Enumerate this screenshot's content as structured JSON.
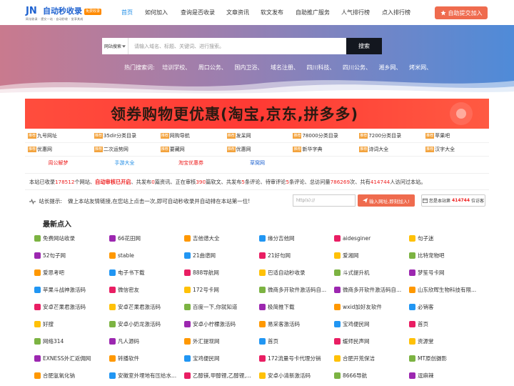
{
  "header": {
    "logo_mark": "JN",
    "logo_title": "自动秒收录",
    "logo_badge": "免费收录",
    "logo_sub": "网址收录 · 提交一站 · 自动秒收 · 坐享其成",
    "nav": [
      "首页",
      "如何加入",
      "查询是否收录",
      "文章资讯",
      "软文发布",
      "自助推广服务",
      "人气排行榜",
      "点入排行榜"
    ],
    "submit_label": "自助提交加入"
  },
  "search": {
    "select_label": "网站搜索",
    "placeholder": "请输入域名、标题、关键词、进行搜索。",
    "button": "搜索",
    "hot_label": "热门搜索词:",
    "hot_words": [
      "培训学校、",
      "周口公务、",
      "国内卫浴、",
      "域名注册、",
      "四川科技、",
      "四川公务、",
      "湘乡网、",
      "烤米网、"
    ]
  },
  "banner": {
    "text": "领券购物更优惠(淘宝,京东,拼多多)"
  },
  "link_rows": [
    [
      {
        "tag": "推荐",
        "label": "九号网址"
      },
      {
        "tag": "推荐",
        "label": "35dir分类目录"
      },
      {
        "tag": "推荐",
        "label": "网购导航"
      },
      {
        "tag": "推荐",
        "label": "发呆网"
      },
      {
        "tag": "推荐",
        "label": "78000分类目录"
      },
      {
        "tag": "推荐",
        "label": "7200分类目录"
      },
      {
        "tag": "推荐",
        "label": "苹果吧"
      }
    ],
    [
      {
        "tag": "推荐",
        "label": "优惠网"
      },
      {
        "tag": "推荐",
        "label": "二次运势网"
      },
      {
        "tag": "推荐",
        "label": "要藏网"
      },
      {
        "tag": "推荐",
        "label": "优惠网"
      },
      {
        "tag": "推荐",
        "label": "新华字典"
      },
      {
        "tag": "推荐",
        "label": "诗词大全"
      },
      {
        "tag": "推荐",
        "label": "汉字大全"
      }
    ]
  ],
  "special_links": [
    {
      "label": "周公解梦",
      "color": "#e22"
    },
    {
      "label": "手游大全",
      "color": "#1e8ce6"
    },
    {
      "label": "淘宝优惠券",
      "color": "#e22"
    },
    {
      "label": "草窝网",
      "color": "#1e62d0"
    }
  ],
  "stats": {
    "p1": "本站已收录",
    "n1": "178512",
    "p2": "个网站、",
    "audit": "自动审核已开启",
    "p3": "、共发布",
    "n2": "0",
    "p4": "篇资讯、正在审核",
    "n3": "390",
    "p5": "篇软文、共发布",
    "n4": "5",
    "p6": "条评论、待审评论",
    "n5": "5",
    "p7": "条评论、总访问量",
    "n6": "786269",
    "p8": "次、共有",
    "n7": "414744",
    "p9": "人访问过本站。"
  },
  "tip": {
    "label": "站长提示:",
    "text": "做上本站友情链接,在您站上点击一次,即可自动秒收录并自动排在本站第一位!",
    "input_placeholder": "http(s)://",
    "submit": "输入网址,即刻加入!",
    "rank_prefix": "您是本站第",
    "rank_num": "414744",
    "rank_suffix": "位访客"
  },
  "latest": {
    "title": "最新点入",
    "rows": [
      [
        "免费网站收录",
        "66花田网",
        "吉他谱大全",
        "缘分吉他网",
        "aidesginer",
        "句子迷"
      ],
      [
        "52句子网",
        "stable",
        "21曲谱网",
        "21好句网",
        "爱湘网",
        "比特宠物吧"
      ],
      [
        "爱思考吧",
        "电子书下载",
        "888导航网",
        "巴适自动秒收录",
        "斗式提升机",
        "梦笙号卡网"
      ],
      [
        "苹果斗战神激活码",
        "微信密友",
        "172号卡网",
        "微商多开软件激活码自...",
        "微商多开软件激活码自...",
        "山东欣晖生物科技有限..."
      ],
      [
        "安卓芒果君激活码",
        "安卓芒果君激活码",
        "百度一下,你就知道",
        "极简推下载",
        "wxid加好友软件",
        "必销客"
      ],
      [
        "好搜",
        "安卓小奶龙激活码",
        "安卓小柠檬激活码",
        "易采客激活码",
        "宝鸡便民网",
        "首页"
      ],
      [
        "网络314",
        "凡人源码",
        "外汇提现网",
        "首页",
        "缓师民声网",
        "资源堂"
      ],
      [
        "EXNESS外汇返佣网",
        "转播软件",
        "宝鸡便民网",
        "172流量号卡代理分销",
        "合肥开荒保洁",
        "MT原创摄影"
      ],
      [
        "合肥氢氧化钠",
        "安徽室外埋地有压给水...",
        "乙醇镁,甲醇锂,乙醇锂,...",
        "安卓小清新激活码",
        "8666导航",
        "逗麻辣"
      ]
    ],
    "icon_colors": [
      "#7cb342",
      "#9c27b0",
      "#ff9800",
      "#2196f3",
      "#e91e63",
      "#ffc107"
    ]
  }
}
